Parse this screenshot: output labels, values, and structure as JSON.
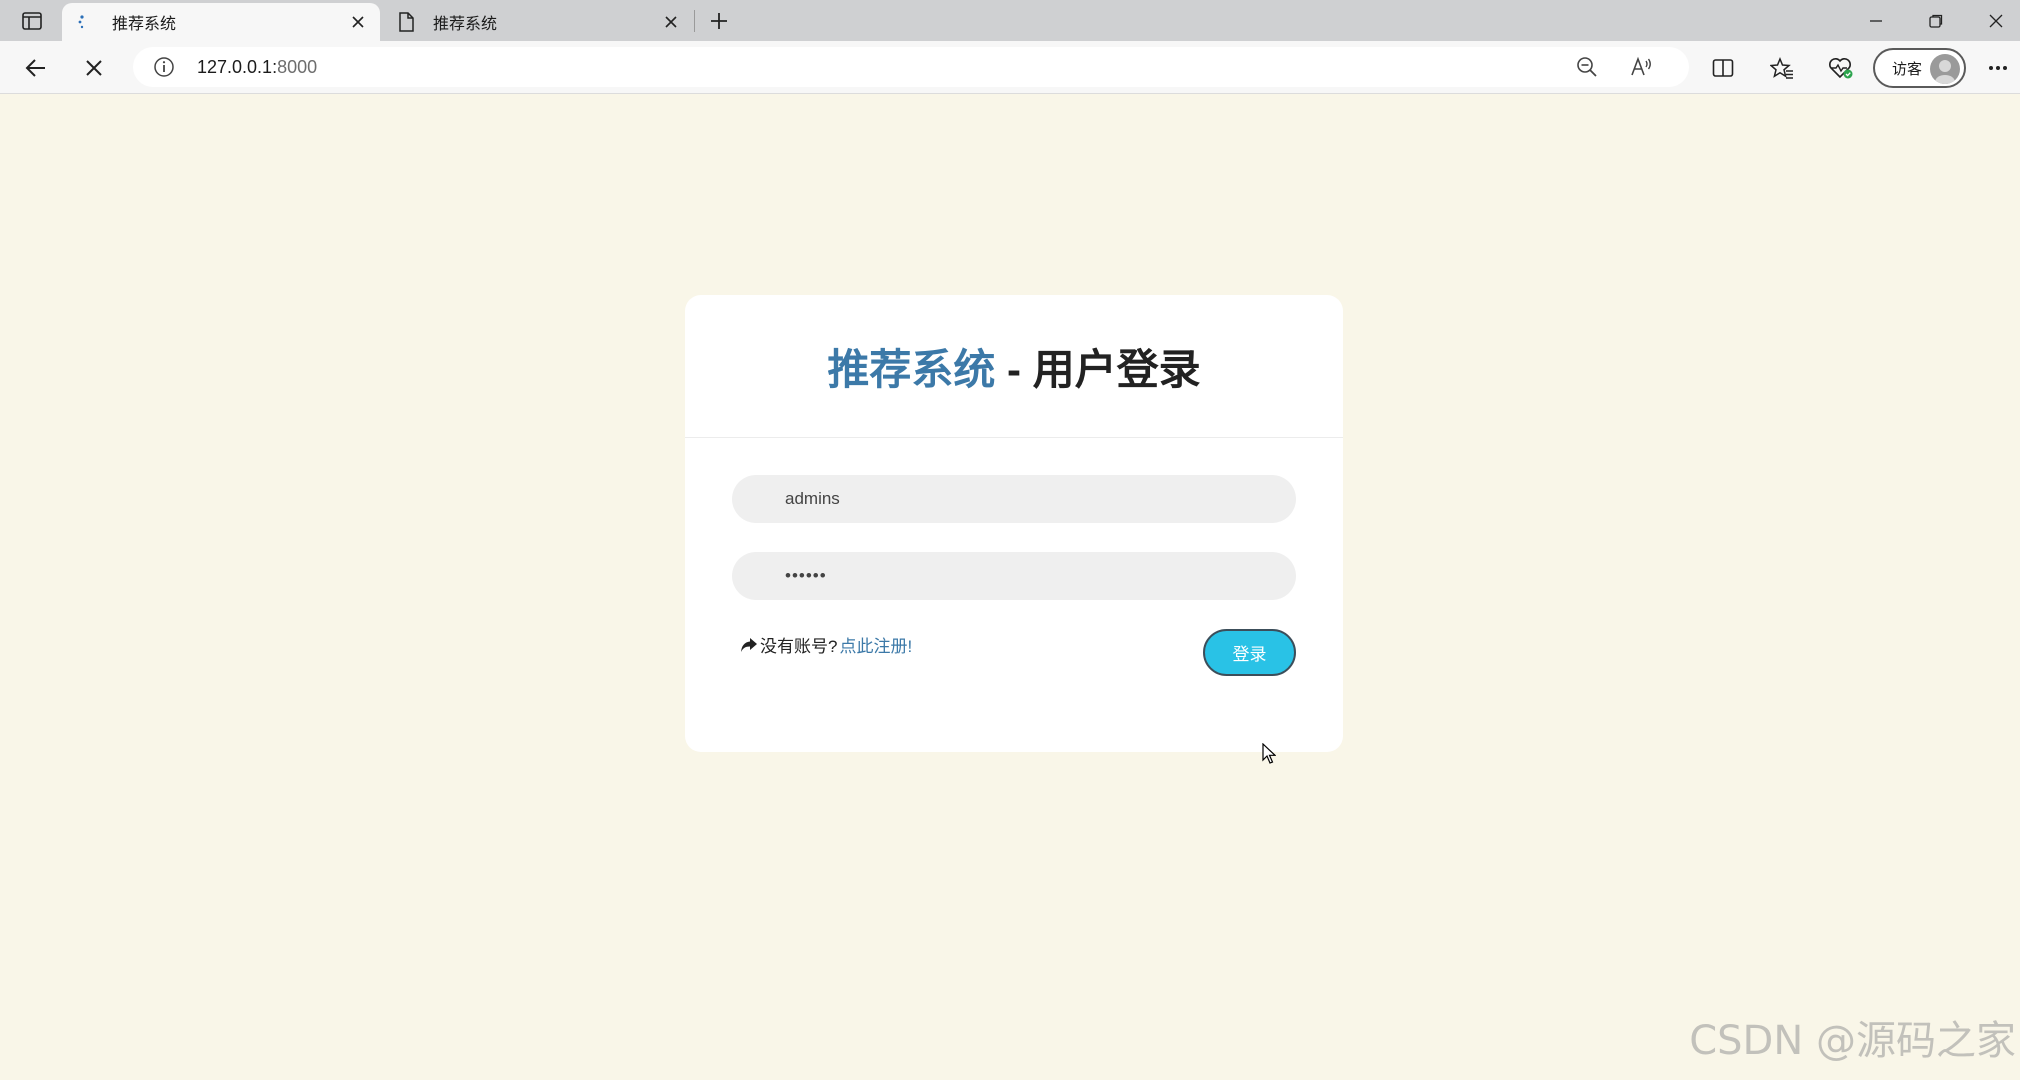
{
  "browser": {
    "tabs": [
      {
        "title": "推荐系统",
        "active": true
      },
      {
        "title": "推荐系统",
        "active": false
      }
    ],
    "address": {
      "host": "127.0.0.1:",
      "port": "8000"
    },
    "profile_label": "访客",
    "icons": {
      "tab_actions": "tab-actions-icon",
      "back": "back-arrow-icon",
      "stop": "stop-loading-icon",
      "site_info": "info-icon",
      "zoom": "zoom-out-icon",
      "read_aloud": "read-aloud-icon",
      "split_screen": "split-screen-icon",
      "favorites": "favorites-icon",
      "browser_essentials": "heart-pulse-icon",
      "more": "more-menu-icon"
    }
  },
  "login": {
    "title_brand": "推荐系统",
    "title_rest": " - 用户登录",
    "username_value": "admins",
    "password_value": "••••••",
    "register_prompt": "没有账号?",
    "register_link": "点此注册!",
    "login_button": "登录"
  },
  "colors": {
    "page_background": "#f9f6e8",
    "brand_blue": "#3c79a8",
    "button_cyan": "#29c2e6"
  },
  "watermark": "CSDN @源码之家"
}
